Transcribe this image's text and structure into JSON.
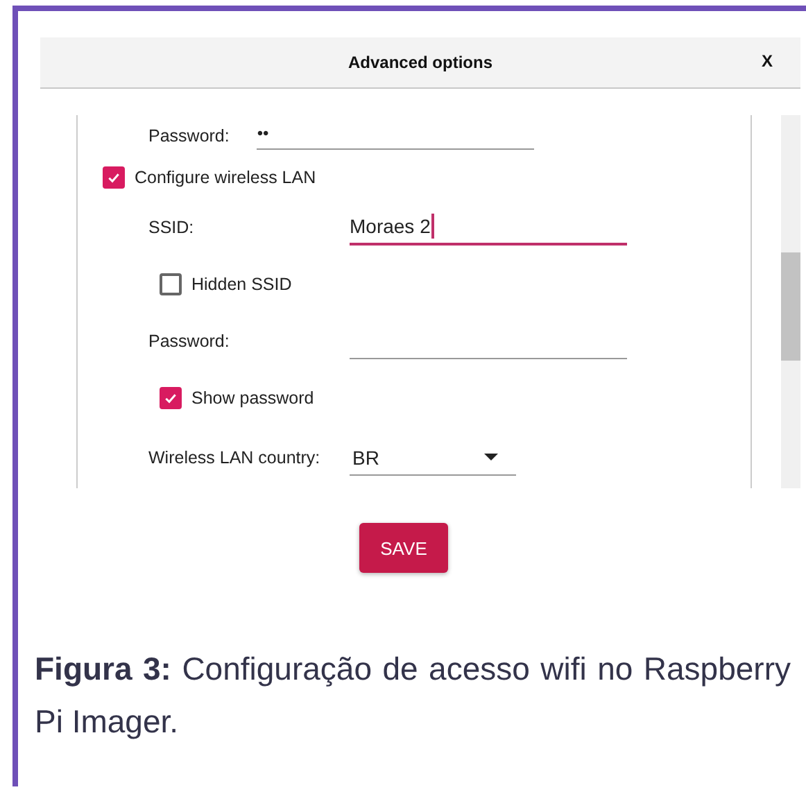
{
  "dialog": {
    "title": "Advanced options",
    "close": "X"
  },
  "rows": [
    {
      "kind": "field",
      "label": "Password:",
      "value": "••",
      "focused": false
    },
    {
      "kind": "checkbox",
      "label": "Configure wireless LAN",
      "checked": true,
      "children": [
        {
          "kind": "field",
          "label": "SSID:",
          "value": "Moraes 2",
          "focused": true
        },
        {
          "kind": "checkbox",
          "label": "Hidden SSID",
          "checked": false
        },
        {
          "kind": "field",
          "label": "Password:",
          "focused": false
        },
        {
          "kind": "checkbox",
          "label": "Show password",
          "checked": true
        },
        {
          "kind": "select",
          "label": "Wireless LAN country:",
          "value": "BR"
        }
      ]
    }
  ],
  "save_button": "SAVE",
  "caption": "**Figura 3:** Configuração de acesso wifi no Raspberry Pi Imager."
}
